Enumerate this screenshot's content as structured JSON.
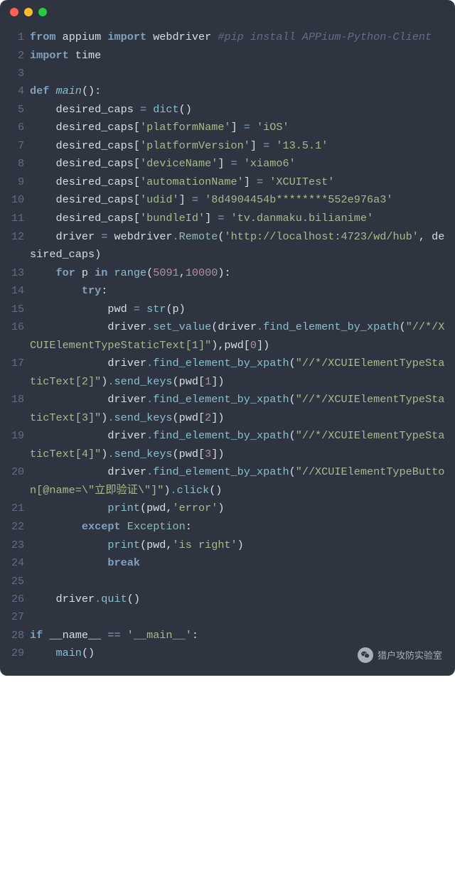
{
  "code": {
    "lines": [
      {
        "n": "1",
        "seg": [
          {
            "c": "kw",
            "t": "from"
          },
          {
            "c": "plain",
            "t": " appium "
          },
          {
            "c": "kw",
            "t": "import"
          },
          {
            "c": "plain",
            "t": " webdriver "
          },
          {
            "c": "cmt",
            "t": "#pip install APPium-Python-Client"
          }
        ]
      },
      {
        "n": "2",
        "seg": [
          {
            "c": "kw",
            "t": "import"
          },
          {
            "c": "plain",
            "t": " time"
          }
        ]
      },
      {
        "n": "3",
        "seg": [
          {
            "c": "plain",
            "t": ""
          }
        ]
      },
      {
        "n": "4",
        "seg": [
          {
            "c": "kw",
            "t": "def"
          },
          {
            "c": "plain",
            "t": " "
          },
          {
            "c": "def",
            "t": "main"
          },
          {
            "c": "plain",
            "t": "():"
          }
        ]
      },
      {
        "n": "5",
        "seg": [
          {
            "c": "plain",
            "t": "    desired_caps "
          },
          {
            "c": "op",
            "t": "="
          },
          {
            "c": "plain",
            "t": " "
          },
          {
            "c": "fn",
            "t": "dict"
          },
          {
            "c": "plain",
            "t": "()"
          }
        ]
      },
      {
        "n": "6",
        "seg": [
          {
            "c": "plain",
            "t": "    desired_caps["
          },
          {
            "c": "str",
            "t": "'platformName'"
          },
          {
            "c": "plain",
            "t": "] "
          },
          {
            "c": "op",
            "t": "="
          },
          {
            "c": "plain",
            "t": " "
          },
          {
            "c": "str",
            "t": "'iOS'"
          }
        ]
      },
      {
        "n": "7",
        "seg": [
          {
            "c": "plain",
            "t": "    desired_caps["
          },
          {
            "c": "str",
            "t": "'platformVersion'"
          },
          {
            "c": "plain",
            "t": "] "
          },
          {
            "c": "op",
            "t": "="
          },
          {
            "c": "plain",
            "t": " "
          },
          {
            "c": "str",
            "t": "'13.5.1'"
          }
        ]
      },
      {
        "n": "8",
        "seg": [
          {
            "c": "plain",
            "t": "    desired_caps["
          },
          {
            "c": "str",
            "t": "'deviceName'"
          },
          {
            "c": "plain",
            "t": "] "
          },
          {
            "c": "op",
            "t": "="
          },
          {
            "c": "plain",
            "t": " "
          },
          {
            "c": "str",
            "t": "'xiamo6'"
          }
        ]
      },
      {
        "n": "9",
        "seg": [
          {
            "c": "plain",
            "t": "    desired_caps["
          },
          {
            "c": "str",
            "t": "'automationName'"
          },
          {
            "c": "plain",
            "t": "] "
          },
          {
            "c": "op",
            "t": "="
          },
          {
            "c": "plain",
            "t": " "
          },
          {
            "c": "str",
            "t": "'XCUITest'"
          }
        ]
      },
      {
        "n": "10",
        "seg": [
          {
            "c": "plain",
            "t": "    desired_caps["
          },
          {
            "c": "str",
            "t": "'udid'"
          },
          {
            "c": "plain",
            "t": "] "
          },
          {
            "c": "op",
            "t": "="
          },
          {
            "c": "plain",
            "t": " "
          },
          {
            "c": "str",
            "t": "'8d4904454b********552e976a3'"
          }
        ]
      },
      {
        "n": "11",
        "seg": [
          {
            "c": "plain",
            "t": "    desired_caps["
          },
          {
            "c": "str",
            "t": "'bundleId'"
          },
          {
            "c": "plain",
            "t": "] "
          },
          {
            "c": "op",
            "t": "="
          },
          {
            "c": "plain",
            "t": " "
          },
          {
            "c": "str",
            "t": "'tv.danmaku.bilianime'"
          }
        ]
      },
      {
        "n": "12",
        "seg": [
          {
            "c": "plain",
            "t": "    driver "
          },
          {
            "c": "op",
            "t": "="
          },
          {
            "c": "plain",
            "t": " webdriver"
          },
          {
            "c": "op",
            "t": "."
          },
          {
            "c": "cls",
            "t": "Remote"
          },
          {
            "c": "plain",
            "t": "("
          },
          {
            "c": "str",
            "t": "'http://localhost:4723/wd/hub'"
          },
          {
            "c": "plain",
            "t": ", desired_caps)"
          }
        ]
      },
      {
        "n": "13",
        "seg": [
          {
            "c": "plain",
            "t": "    "
          },
          {
            "c": "kw",
            "t": "for"
          },
          {
            "c": "plain",
            "t": " p "
          },
          {
            "c": "kw",
            "t": "in"
          },
          {
            "c": "plain",
            "t": " "
          },
          {
            "c": "fn",
            "t": "range"
          },
          {
            "c": "plain",
            "t": "("
          },
          {
            "c": "num",
            "t": "5091"
          },
          {
            "c": "plain",
            "t": ","
          },
          {
            "c": "num",
            "t": "10000"
          },
          {
            "c": "plain",
            "t": "):"
          }
        ]
      },
      {
        "n": "14",
        "seg": [
          {
            "c": "plain",
            "t": "        "
          },
          {
            "c": "kw",
            "t": "try"
          },
          {
            "c": "plain",
            "t": ":"
          }
        ]
      },
      {
        "n": "15",
        "seg": [
          {
            "c": "plain",
            "t": "            pwd "
          },
          {
            "c": "op",
            "t": "="
          },
          {
            "c": "plain",
            "t": " "
          },
          {
            "c": "fn",
            "t": "str"
          },
          {
            "c": "plain",
            "t": "(p)"
          }
        ]
      },
      {
        "n": "16",
        "seg": [
          {
            "c": "plain",
            "t": "            driver"
          },
          {
            "c": "op",
            "t": "."
          },
          {
            "c": "callname",
            "t": "set_value"
          },
          {
            "c": "plain",
            "t": "(driver"
          },
          {
            "c": "op",
            "t": "."
          },
          {
            "c": "callname",
            "t": "find_element_by_xpath"
          },
          {
            "c": "plain",
            "t": "("
          },
          {
            "c": "str",
            "t": "\"//*/XCUIElementTypeStaticText[1]\""
          },
          {
            "c": "plain",
            "t": "),pwd["
          },
          {
            "c": "num",
            "t": "0"
          },
          {
            "c": "plain",
            "t": "])"
          }
        ],
        "xindent": true
      },
      {
        "n": "17",
        "seg": [
          {
            "c": "plain",
            "t": "            driver"
          },
          {
            "c": "op",
            "t": "."
          },
          {
            "c": "callname",
            "t": "find_element_by_xpath"
          },
          {
            "c": "plain",
            "t": "("
          },
          {
            "c": "str",
            "t": "\"//*/XCUIElementTypeStaticText[2]\""
          },
          {
            "c": "plain",
            "t": ")"
          },
          {
            "c": "op",
            "t": "."
          },
          {
            "c": "callname",
            "t": "send_keys"
          },
          {
            "c": "plain",
            "t": "(pwd["
          },
          {
            "c": "num",
            "t": "1"
          },
          {
            "c": "plain",
            "t": "])"
          }
        ],
        "xindent": true
      },
      {
        "n": "18",
        "seg": [
          {
            "c": "plain",
            "t": "            driver"
          },
          {
            "c": "op",
            "t": "."
          },
          {
            "c": "callname",
            "t": "find_element_by_xpath"
          },
          {
            "c": "plain",
            "t": "("
          },
          {
            "c": "str",
            "t": "\"//*/XCUIElementTypeStaticText[3]\""
          },
          {
            "c": "plain",
            "t": ")"
          },
          {
            "c": "op",
            "t": "."
          },
          {
            "c": "callname",
            "t": "send_keys"
          },
          {
            "c": "plain",
            "t": "(pwd["
          },
          {
            "c": "num",
            "t": "2"
          },
          {
            "c": "plain",
            "t": "])"
          }
        ],
        "xindent": true
      },
      {
        "n": "19",
        "seg": [
          {
            "c": "plain",
            "t": "            driver"
          },
          {
            "c": "op",
            "t": "."
          },
          {
            "c": "callname",
            "t": "find_element_by_xpath"
          },
          {
            "c": "plain",
            "t": "("
          },
          {
            "c": "str",
            "t": "\"//*/XCUIElementTypeStaticText[4]\""
          },
          {
            "c": "plain",
            "t": ")"
          },
          {
            "c": "op",
            "t": "."
          },
          {
            "c": "callname",
            "t": "send_keys"
          },
          {
            "c": "plain",
            "t": "(pwd["
          },
          {
            "c": "num",
            "t": "3"
          },
          {
            "c": "plain",
            "t": "])"
          }
        ],
        "xindent": true
      },
      {
        "n": "20",
        "seg": [
          {
            "c": "plain",
            "t": "            driver"
          },
          {
            "c": "op",
            "t": "."
          },
          {
            "c": "callname",
            "t": "find_element_by_xpath"
          },
          {
            "c": "plain",
            "t": "("
          },
          {
            "c": "str",
            "t": "\"//XCUIElementTypeButton[@name=\\\"立即验证\\\"]\""
          },
          {
            "c": "plain",
            "t": ")"
          },
          {
            "c": "op",
            "t": "."
          },
          {
            "c": "callname",
            "t": "click"
          },
          {
            "c": "plain",
            "t": "()"
          }
        ],
        "xindent": true
      },
      {
        "n": "21",
        "seg": [
          {
            "c": "plain",
            "t": "            "
          },
          {
            "c": "fn",
            "t": "print"
          },
          {
            "c": "plain",
            "t": "(pwd,"
          },
          {
            "c": "str",
            "t": "'error'"
          },
          {
            "c": "plain",
            "t": ")"
          }
        ]
      },
      {
        "n": "22",
        "seg": [
          {
            "c": "plain",
            "t": "        "
          },
          {
            "c": "kw",
            "t": "except"
          },
          {
            "c": "plain",
            "t": " "
          },
          {
            "c": "cls",
            "t": "Exception"
          },
          {
            "c": "plain",
            "t": ":"
          }
        ]
      },
      {
        "n": "23",
        "seg": [
          {
            "c": "plain",
            "t": "            "
          },
          {
            "c": "fn",
            "t": "print"
          },
          {
            "c": "plain",
            "t": "(pwd,"
          },
          {
            "c": "str",
            "t": "'is right'"
          },
          {
            "c": "plain",
            "t": ")"
          }
        ]
      },
      {
        "n": "24",
        "seg": [
          {
            "c": "plain",
            "t": "            "
          },
          {
            "c": "kw",
            "t": "break"
          }
        ]
      },
      {
        "n": "25",
        "seg": [
          {
            "c": "plain",
            "t": ""
          }
        ]
      },
      {
        "n": "26",
        "seg": [
          {
            "c": "plain",
            "t": "    driver"
          },
          {
            "c": "op",
            "t": "."
          },
          {
            "c": "callname",
            "t": "quit"
          },
          {
            "c": "plain",
            "t": "()"
          }
        ]
      },
      {
        "n": "27",
        "seg": [
          {
            "c": "plain",
            "t": ""
          }
        ]
      },
      {
        "n": "28",
        "seg": [
          {
            "c": "kw",
            "t": "if"
          },
          {
            "c": "plain",
            "t": " __name__ "
          },
          {
            "c": "op",
            "t": "=="
          },
          {
            "c": "plain",
            "t": " "
          },
          {
            "c": "str",
            "t": "'__main__'"
          },
          {
            "c": "plain",
            "t": ":"
          }
        ]
      },
      {
        "n": "29",
        "seg": [
          {
            "c": "plain",
            "t": "    "
          },
          {
            "c": "callname",
            "t": "main"
          },
          {
            "c": "plain",
            "t": "()"
          }
        ]
      }
    ]
  },
  "footer": {
    "label": "猎户攻防实验室"
  }
}
